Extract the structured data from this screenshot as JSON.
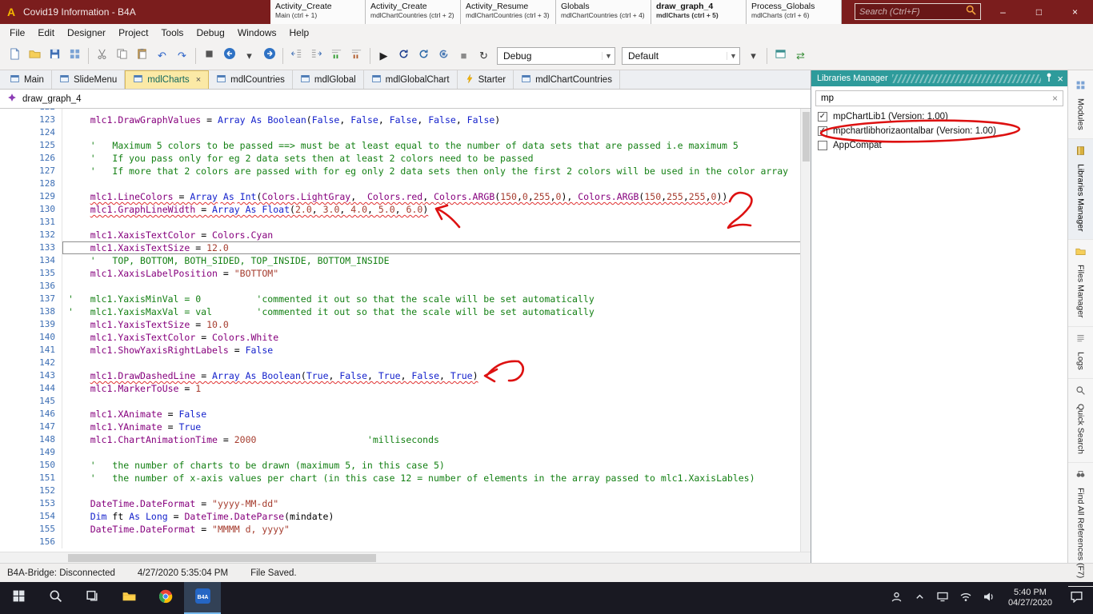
{
  "window": {
    "title": "Covid19 Information - B4A",
    "app_badge": "A"
  },
  "titlebar": {
    "search_placeholder": "Search (Ctrl+F)",
    "quick_tabs": [
      {
        "label": "Activity_Create",
        "sub": "Main  (ctrl + 1)",
        "active": false
      },
      {
        "label": "Activity_Create",
        "sub": "mdlChartCountries  (ctrl + 2)",
        "active": false
      },
      {
        "label": "Activity_Resume",
        "sub": "mdlChartCountries  (ctrl + 3)",
        "active": false
      },
      {
        "label": "Globals",
        "sub": "mdlChartCountries  (ctrl + 4)",
        "active": false
      },
      {
        "label": "draw_graph_4",
        "sub": "mdlCharts  (ctrl + 5)",
        "active": true
      },
      {
        "label": "Process_Globals",
        "sub": "mdlCharts  (ctrl + 6)",
        "active": false
      }
    ],
    "window_buttons": [
      {
        "name": "minimize-button",
        "glyph": "–"
      },
      {
        "name": "maximize-button",
        "glyph": "□"
      },
      {
        "name": "close-button",
        "glyph": "×"
      }
    ]
  },
  "menubar": {
    "items": [
      "File",
      "Edit",
      "Designer",
      "Project",
      "Tools",
      "Debug",
      "Windows",
      "Help"
    ]
  },
  "toolbar": {
    "debug_mode": "Debug",
    "build_configuration": "Default",
    "items": [
      {
        "name": "new-icon"
      },
      {
        "name": "open-project-icon"
      },
      {
        "name": "save-icon"
      },
      {
        "name": "modules-grid-icon"
      },
      {
        "sep": true
      },
      {
        "name": "cut-icon"
      },
      {
        "name": "copy-icon"
      },
      {
        "name": "paste-icon"
      },
      {
        "name": "undo-icon"
      },
      {
        "name": "redo-icon"
      },
      {
        "sep": true
      },
      {
        "name": "bookmark-icon"
      },
      {
        "name": "navigate-back-icon"
      },
      {
        "name": "history-dropdown-icon"
      },
      {
        "name": "navigate-forward-icon"
      },
      {
        "sep": true
      },
      {
        "name": "outdent-icon"
      },
      {
        "name": "indent-icon"
      },
      {
        "name": "comment-icon"
      },
      {
        "name": "uncomment-icon"
      },
      {
        "sep": true
      },
      {
        "name": "run-icon"
      },
      {
        "name": "compile-debug-icon"
      },
      {
        "name": "compile-release-icon"
      },
      {
        "name": "clean-project-icon"
      },
      {
        "name": "stop-icon"
      },
      {
        "name": "restart-icon"
      },
      {
        "combo": "debug_mode",
        "name": "debug-mode-combo"
      },
      {
        "combo": "build_configuration",
        "name": "build-configuration-combo"
      },
      {
        "name": "config-dropdown-icon"
      },
      {
        "sep": true
      },
      {
        "name": "visual-designer-icon"
      },
      {
        "name": "sync-icon"
      }
    ]
  },
  "module_tabs": [
    {
      "label": "Main",
      "icon": "module-icon",
      "active": false,
      "closable": false
    },
    {
      "label": "SlideMenu",
      "icon": "module-icon",
      "active": false,
      "closable": false
    },
    {
      "label": "mdlCharts",
      "icon": "module-icon",
      "active": true,
      "closable": true
    },
    {
      "label": "mdlCountries",
      "icon": "module-icon",
      "active": false,
      "closable": false
    },
    {
      "label": "mdlGlobal",
      "icon": "module-icon",
      "active": false,
      "closable": false
    },
    {
      "label": "mdlGlobalChart",
      "icon": "module-icon",
      "active": false,
      "closable": false
    },
    {
      "label": "Starter",
      "icon": "lightning-icon",
      "active": false,
      "closable": false
    },
    {
      "label": "mdlChartCountries",
      "icon": "module-icon",
      "active": false,
      "closable": false
    }
  ],
  "editor": {
    "procedure_label": "draw_graph_4",
    "code_lines": [
      {
        "n": 122,
        "t": ""
      },
      {
        "n": 123,
        "t": "    mlc1.DrawGraphValues = Array As Boolean(False, False, False, False, False)"
      },
      {
        "n": 124,
        "t": ""
      },
      {
        "n": 125,
        "t": "    '   Maximum 5 colors to be passed ==> must be at least equal to the number of data sets that are passed i.e maximum 5"
      },
      {
        "n": 126,
        "t": "    '   If you pass only for eg 2 data sets then at least 2 colors need to be passed"
      },
      {
        "n": 127,
        "t": "    '   If more that 2 colors are passed with for eg only 2 data sets then only the first 2 colors will be used in the color array"
      },
      {
        "n": 128,
        "t": ""
      },
      {
        "n": 129,
        "t": "    mlc1.LineColors = Array As Int(Colors.LightGray,  Colors.red, Colors.ARGB(150,0,255,0), Colors.ARGB(150,255,255,0))",
        "squiggle": true
      },
      {
        "n": 130,
        "t": "    mlc1.GraphLineWidth = Array As Float(2.0, 3.0, 4.0, 5.0, 6.0)",
        "squiggle": true
      },
      {
        "n": 131,
        "t": ""
      },
      {
        "n": 132,
        "t": "    mlc1.XaxisTextColor = Colors.Cyan"
      },
      {
        "n": 133,
        "t": "    mlc1.XaxisTextSize = 12.0",
        "current": true
      },
      {
        "n": 134,
        "t": "    '   TOP, BOTTOM, BOTH_SIDED, TOP_INSIDE, BOTTOM_INSIDE"
      },
      {
        "n": 135,
        "t": "    mlc1.XaxisLabelPosition = \"BOTTOM\""
      },
      {
        "n": 136,
        "t": ""
      },
      {
        "n": 137,
        "t": "'   mlc1.YaxisMinVal = 0          'commented it out so that the scale will be set automatically"
      },
      {
        "n": 138,
        "t": "'   mlc1.YaxisMaxVal = val        'commented it out so that the scale will be set automatically"
      },
      {
        "n": 139,
        "t": "    mlc1.YaxisTextSize = 10.0"
      },
      {
        "n": 140,
        "t": "    mlc1.YaxisTextColor = Colors.White"
      },
      {
        "n": 141,
        "t": "    mlc1.ShowYaxisRightLabels = False"
      },
      {
        "n": 142,
        "t": ""
      },
      {
        "n": 143,
        "t": "    mlc1.DrawDashedLine = Array As Boolean(True, False, True, False, True)",
        "squiggle": true
      },
      {
        "n": 144,
        "t": "    mlc1.MarkerToUse = 1"
      },
      {
        "n": 145,
        "t": ""
      },
      {
        "n": 146,
        "t": "    mlc1.XAnimate = False"
      },
      {
        "n": 147,
        "t": "    mlc1.YAnimate = True"
      },
      {
        "n": 148,
        "t": "    mlc1.ChartAnimationTime = 2000                    'milliseconds"
      },
      {
        "n": 149,
        "t": ""
      },
      {
        "n": 150,
        "t": "    '   the number of charts to be drawn (maximum 5, in this case 5)"
      },
      {
        "n": 151,
        "t": "    '   the number of x-axis values per chart (in this case 12 = number of elements in the array passed to mlc1.XaxisLables)"
      },
      {
        "n": 152,
        "t": ""
      },
      {
        "n": 153,
        "t": "    DateTime.DateFormat = \"yyyy-MM-dd\""
      },
      {
        "n": 154,
        "t": "    Dim ft As Long = DateTime.DateParse(mindate)"
      },
      {
        "n": 155,
        "t": "    DateTime.DateFormat = \"MMMM d, yyyy\""
      },
      {
        "n": 156,
        "t": ""
      }
    ]
  },
  "libraries_manager": {
    "title": "Libraries Manager",
    "search_value": "mp",
    "items": [
      {
        "label": "mpChartLib1 (Version: 1.00)",
        "checked": true,
        "annotated": false
      },
      {
        "label": "mpchartlibhorizaontalbar (Version: 1.00)",
        "checked": true,
        "annotated": true
      },
      {
        "label": "AppCompat",
        "checked": false,
        "annotated": false
      }
    ]
  },
  "side_tabs": [
    {
      "label": "Modules",
      "icon": "modules-icon",
      "active": false
    },
    {
      "label": "Libraries Manager",
      "icon": "libraries-icon",
      "active": true
    },
    {
      "label": "Files Manager",
      "icon": "files-icon",
      "active": false
    },
    {
      "label": "Logs",
      "icon": "logs-icon",
      "active": false
    },
    {
      "label": "Quick Search",
      "icon": "quick-search-icon",
      "active": false
    },
    {
      "label": "Find All References (F7)",
      "icon": "references-icon",
      "active": false
    }
  ],
  "statusbar": {
    "bridge_status": "B4A-Bridge: Disconnected",
    "saved_timestamp": "4/27/2020 5:35:04 PM",
    "file_status": "File Saved."
  },
  "taskbar": {
    "apps": [
      {
        "name": "start-button",
        "icon": "start-icon",
        "active": false
      },
      {
        "name": "taskbar-search-button",
        "icon": "taskbar-search-icon",
        "active": false
      },
      {
        "name": "task-view-button",
        "icon": "task-view-icon",
        "active": false
      },
      {
        "name": "file-explorer-button",
        "icon": "explorer-icon",
        "active": false
      },
      {
        "name": "chrome-button",
        "icon": "chrome-icon",
        "active": false
      },
      {
        "name": "b4a-button",
        "icon": "b4a-icon",
        "active": true
      }
    ],
    "tray": [
      {
        "name": "people-button",
        "icon": "people-icon"
      },
      {
        "name": "hidden-icons-button",
        "icon": "chevron-up-icon"
      },
      {
        "name": "network-button",
        "icon": "network-icon"
      },
      {
        "name": "wifi-button",
        "icon": "wifi-icon"
      },
      {
        "name": "volume-button",
        "icon": "volume-icon"
      }
    ],
    "clock": {
      "time": "5:40 PM",
      "date": "04/27/2020"
    },
    "action_center": {
      "name": "action-center-button",
      "icon": "action-center-icon"
    }
  },
  "annotations": {
    "color": "#dd1111",
    "marks": [
      {
        "type": "ellipse",
        "label": "circle-around-mpchartlibhorizaontalbar"
      },
      {
        "type": "scribble",
        "label": "handwritten-2-beside-line-129"
      },
      {
        "type": "arrow",
        "label": "arrow-to-end-of-line-130"
      },
      {
        "type": "arrow",
        "label": "arrow-to-end-of-line-143"
      }
    ]
  }
}
